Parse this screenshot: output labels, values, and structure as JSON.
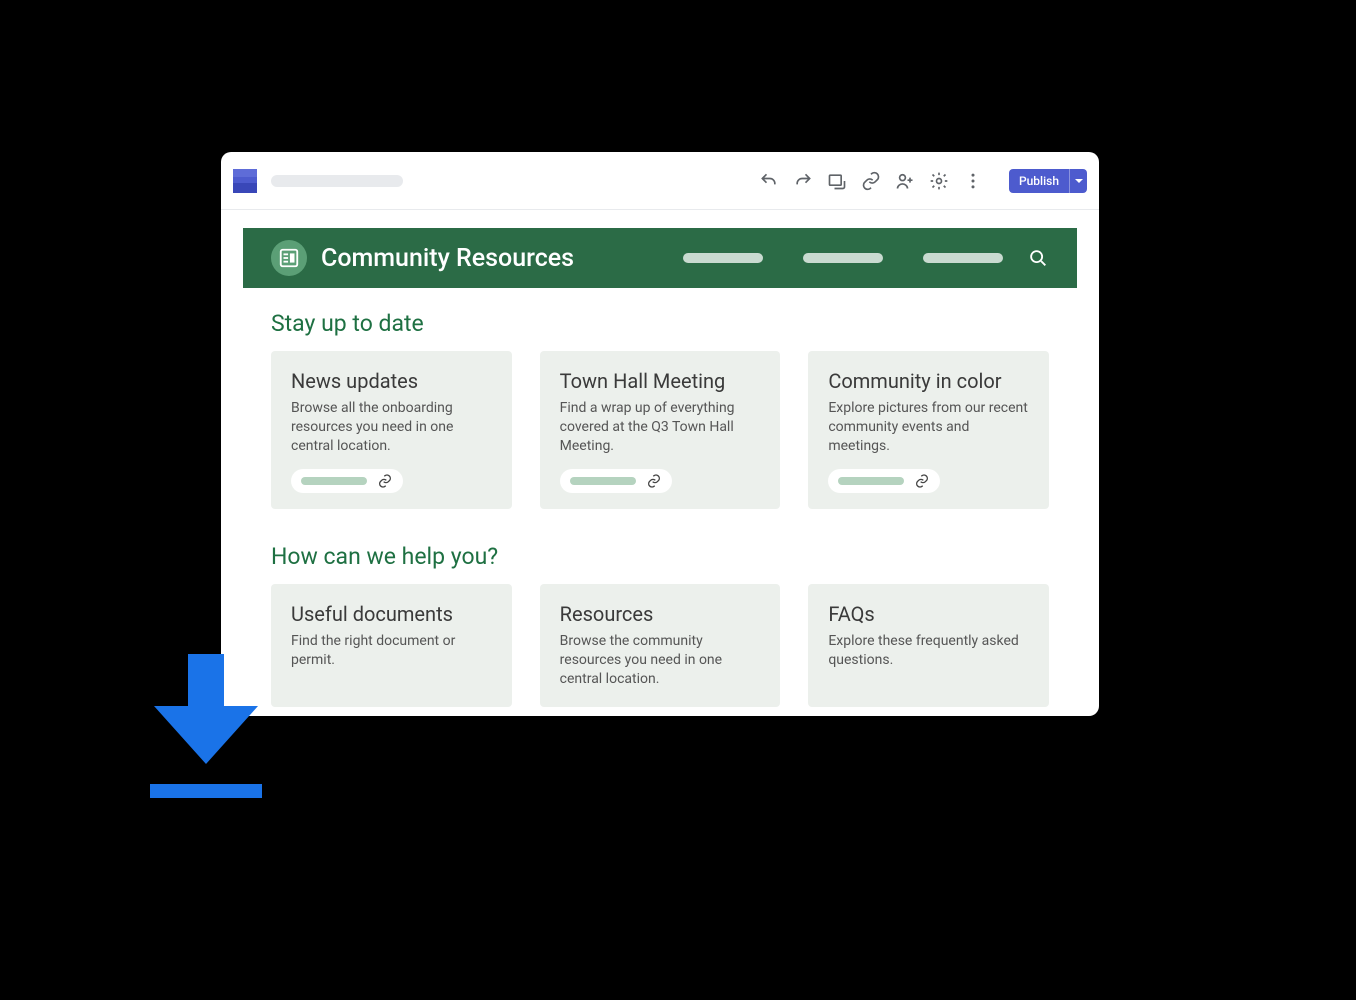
{
  "appbar": {
    "publish_label": "Publish"
  },
  "site": {
    "title": "Community Resources"
  },
  "sections": [
    {
      "title": "Stay up to date",
      "cards": [
        {
          "title": "News updates",
          "desc": "Browse all the onboarding resources you need in one central location."
        },
        {
          "title": "Town Hall Meeting",
          "desc": "Find a wrap up of everything covered at the Q3 Town Hall Meeting."
        },
        {
          "title": "Community in color",
          "desc": "Explore pictures from our recent community events and meetings."
        }
      ]
    },
    {
      "title": "How can we help you?",
      "cards": [
        {
          "title": "Useful documents",
          "desc": "Find the right document or permit."
        },
        {
          "title": "Resources",
          "desc": "Browse the community resources you need in one central location."
        },
        {
          "title": "FAQs",
          "desc": "Explore these frequently asked questions."
        }
      ]
    }
  ]
}
